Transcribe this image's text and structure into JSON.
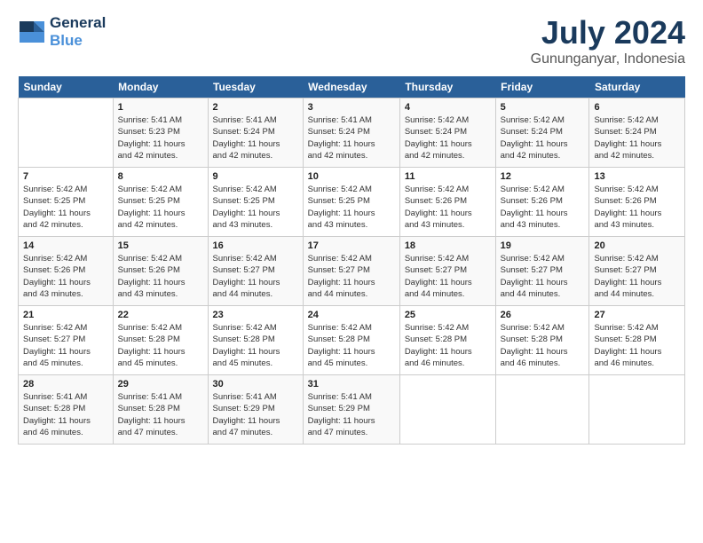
{
  "header": {
    "logo_line1": "General",
    "logo_line2": "Blue",
    "month_title": "July 2024",
    "location": "Gununganyar, Indonesia"
  },
  "weekdays": [
    "Sunday",
    "Monday",
    "Tuesday",
    "Wednesday",
    "Thursday",
    "Friday",
    "Saturday"
  ],
  "weeks": [
    [
      {
        "day": "",
        "info": ""
      },
      {
        "day": "1",
        "info": "Sunrise: 5:41 AM\nSunset: 5:23 PM\nDaylight: 11 hours\nand 42 minutes."
      },
      {
        "day": "2",
        "info": "Sunrise: 5:41 AM\nSunset: 5:24 PM\nDaylight: 11 hours\nand 42 minutes."
      },
      {
        "day": "3",
        "info": "Sunrise: 5:41 AM\nSunset: 5:24 PM\nDaylight: 11 hours\nand 42 minutes."
      },
      {
        "day": "4",
        "info": "Sunrise: 5:42 AM\nSunset: 5:24 PM\nDaylight: 11 hours\nand 42 minutes."
      },
      {
        "day": "5",
        "info": "Sunrise: 5:42 AM\nSunset: 5:24 PM\nDaylight: 11 hours\nand 42 minutes."
      },
      {
        "day": "6",
        "info": "Sunrise: 5:42 AM\nSunset: 5:24 PM\nDaylight: 11 hours\nand 42 minutes."
      }
    ],
    [
      {
        "day": "7",
        "info": "Sunrise: 5:42 AM\nSunset: 5:25 PM\nDaylight: 11 hours\nand 42 minutes."
      },
      {
        "day": "8",
        "info": "Sunrise: 5:42 AM\nSunset: 5:25 PM\nDaylight: 11 hours\nand 42 minutes."
      },
      {
        "day": "9",
        "info": "Sunrise: 5:42 AM\nSunset: 5:25 PM\nDaylight: 11 hours\nand 43 minutes."
      },
      {
        "day": "10",
        "info": "Sunrise: 5:42 AM\nSunset: 5:25 PM\nDaylight: 11 hours\nand 43 minutes."
      },
      {
        "day": "11",
        "info": "Sunrise: 5:42 AM\nSunset: 5:26 PM\nDaylight: 11 hours\nand 43 minutes."
      },
      {
        "day": "12",
        "info": "Sunrise: 5:42 AM\nSunset: 5:26 PM\nDaylight: 11 hours\nand 43 minutes."
      },
      {
        "day": "13",
        "info": "Sunrise: 5:42 AM\nSunset: 5:26 PM\nDaylight: 11 hours\nand 43 minutes."
      }
    ],
    [
      {
        "day": "14",
        "info": "Sunrise: 5:42 AM\nSunset: 5:26 PM\nDaylight: 11 hours\nand 43 minutes."
      },
      {
        "day": "15",
        "info": "Sunrise: 5:42 AM\nSunset: 5:26 PM\nDaylight: 11 hours\nand 43 minutes."
      },
      {
        "day": "16",
        "info": "Sunrise: 5:42 AM\nSunset: 5:27 PM\nDaylight: 11 hours\nand 44 minutes."
      },
      {
        "day": "17",
        "info": "Sunrise: 5:42 AM\nSunset: 5:27 PM\nDaylight: 11 hours\nand 44 minutes."
      },
      {
        "day": "18",
        "info": "Sunrise: 5:42 AM\nSunset: 5:27 PM\nDaylight: 11 hours\nand 44 minutes."
      },
      {
        "day": "19",
        "info": "Sunrise: 5:42 AM\nSunset: 5:27 PM\nDaylight: 11 hours\nand 44 minutes."
      },
      {
        "day": "20",
        "info": "Sunrise: 5:42 AM\nSunset: 5:27 PM\nDaylight: 11 hours\nand 44 minutes."
      }
    ],
    [
      {
        "day": "21",
        "info": "Sunrise: 5:42 AM\nSunset: 5:27 PM\nDaylight: 11 hours\nand 45 minutes."
      },
      {
        "day": "22",
        "info": "Sunrise: 5:42 AM\nSunset: 5:28 PM\nDaylight: 11 hours\nand 45 minutes."
      },
      {
        "day": "23",
        "info": "Sunrise: 5:42 AM\nSunset: 5:28 PM\nDaylight: 11 hours\nand 45 minutes."
      },
      {
        "day": "24",
        "info": "Sunrise: 5:42 AM\nSunset: 5:28 PM\nDaylight: 11 hours\nand 45 minutes."
      },
      {
        "day": "25",
        "info": "Sunrise: 5:42 AM\nSunset: 5:28 PM\nDaylight: 11 hours\nand 46 minutes."
      },
      {
        "day": "26",
        "info": "Sunrise: 5:42 AM\nSunset: 5:28 PM\nDaylight: 11 hours\nand 46 minutes."
      },
      {
        "day": "27",
        "info": "Sunrise: 5:42 AM\nSunset: 5:28 PM\nDaylight: 11 hours\nand 46 minutes."
      }
    ],
    [
      {
        "day": "28",
        "info": "Sunrise: 5:41 AM\nSunset: 5:28 PM\nDaylight: 11 hours\nand 46 minutes."
      },
      {
        "day": "29",
        "info": "Sunrise: 5:41 AM\nSunset: 5:28 PM\nDaylight: 11 hours\nand 47 minutes."
      },
      {
        "day": "30",
        "info": "Sunrise: 5:41 AM\nSunset: 5:29 PM\nDaylight: 11 hours\nand 47 minutes."
      },
      {
        "day": "31",
        "info": "Sunrise: 5:41 AM\nSunset: 5:29 PM\nDaylight: 11 hours\nand 47 minutes."
      },
      {
        "day": "",
        "info": ""
      },
      {
        "day": "",
        "info": ""
      },
      {
        "day": "",
        "info": ""
      }
    ]
  ]
}
